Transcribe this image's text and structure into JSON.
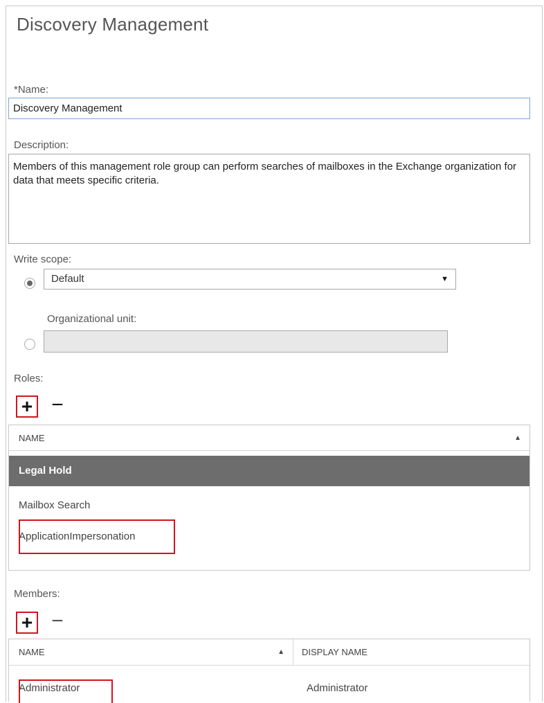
{
  "dialog": {
    "title": "Discovery Management"
  },
  "form": {
    "name_label": "*Name:",
    "name_value": "Discovery Management",
    "description_label": "Description:",
    "description_value": "Members of this management role group can perform searches of mailboxes in the Exchange organization for data that meets specific criteria.",
    "write_scope_label": "Write scope:",
    "write_scope_selected": "Default",
    "ou_label": "Organizational unit:",
    "ou_value": ""
  },
  "roles": {
    "label": "Roles:",
    "add_icon": "+",
    "remove_icon": "−",
    "header_name": "NAME",
    "sort_icon": "▲",
    "rows": [
      {
        "name": "Legal Hold",
        "selected": true
      },
      {
        "name": "Mailbox Search",
        "selected": false
      },
      {
        "name": "ApplicationImpersonation",
        "selected": false,
        "highlighted": true
      }
    ]
  },
  "members": {
    "label": "Members:",
    "add_icon": "+",
    "remove_icon": "−",
    "header_name": "NAME",
    "header_display_name": "DISPLAY NAME",
    "sort_icon": "▲",
    "rows": [
      {
        "name": "Administrator",
        "display_name": "Administrator",
        "highlighted": true
      }
    ]
  },
  "colors": {
    "highlight_border": "#d0151e",
    "selected_row_bg": "#6d6d6d",
    "focus_border": "#7ea6d8"
  }
}
